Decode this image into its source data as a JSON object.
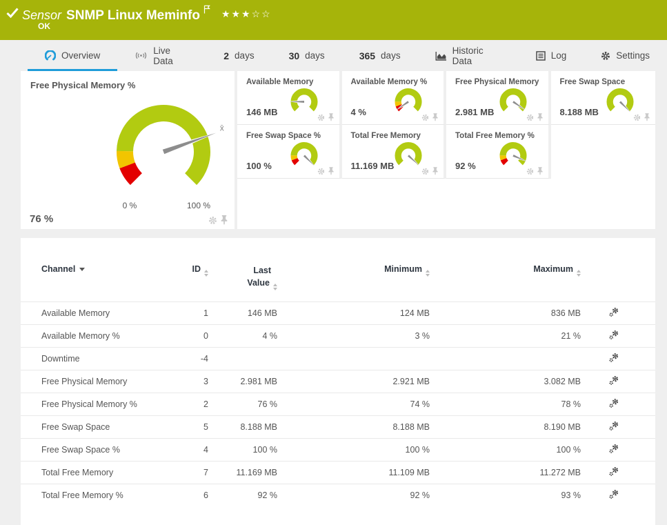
{
  "header": {
    "type_label": "Sensor",
    "title": "SNMP Linux Meminfo",
    "status": "OK",
    "stars_filled": 3,
    "stars_empty": 2
  },
  "tabs": {
    "overview": {
      "label": "Overview"
    },
    "live_data": {
      "label": "Live Data"
    },
    "days2": {
      "number": "2",
      "suffix": "days"
    },
    "days30": {
      "number": "30",
      "suffix": "days"
    },
    "days365": {
      "number": "365",
      "suffix": "days"
    },
    "historic": {
      "label": "Historic Data"
    },
    "log": {
      "label": "Log"
    },
    "settings": {
      "label": "Settings"
    }
  },
  "overview": {
    "main_gauge": {
      "title": "Free Physical Memory %",
      "value_label": "76 %",
      "value_pct": 76,
      "segments": "warn",
      "scale_min": "0 %",
      "scale_max": "100 %",
      "mean_marker": "x̄"
    },
    "mini_gauges": [
      {
        "title": "Available Memory",
        "value_label": "146 MB",
        "value_pct": 17,
        "segments": "plain"
      },
      {
        "title": "Available Memory %",
        "value_label": "4 %",
        "value_pct": 4,
        "segments": "warn"
      },
      {
        "title": "Free Physical Memory",
        "value_label": "2.981 MB",
        "value_pct": 96,
        "segments": "plain"
      },
      {
        "title": "Free Swap Space",
        "value_label": "8.188 MB",
        "value_pct": 100,
        "segments": "plain"
      },
      {
        "title": "Free Swap Space %",
        "value_label": "100 %",
        "value_pct": 100,
        "segments": "warn"
      },
      {
        "title": "Total Free Memory",
        "value_label": "11.169 MB",
        "value_pct": 99,
        "segments": "plain"
      },
      {
        "title": "Total Free Memory %",
        "value_label": "92 %",
        "value_pct": 92,
        "segments": "warn"
      }
    ]
  },
  "table": {
    "columns": {
      "channel": {
        "label": "Channel"
      },
      "id": {
        "label": "ID"
      },
      "last_value": {
        "label_line1": "Last",
        "label_line2": "Value"
      },
      "minimum": {
        "label": "Minimum"
      },
      "maximum": {
        "label": "Maximum"
      }
    },
    "rows": [
      {
        "name": "Available Memory",
        "id": "1",
        "last": "146 MB",
        "min": "124 MB",
        "max": "836 MB"
      },
      {
        "name": "Available Memory %",
        "id": "0",
        "last": "4 %",
        "min": "3 %",
        "max": "21 %"
      },
      {
        "name": "Downtime",
        "id": "-4",
        "last": "",
        "min": "",
        "max": ""
      },
      {
        "name": "Free Physical Memory",
        "id": "3",
        "last": "2.981 MB",
        "min": "2.921 MB",
        "max": "3.082 MB"
      },
      {
        "name": "Free Physical Memory %",
        "id": "2",
        "last": "76 %",
        "min": "74 %",
        "max": "78 %"
      },
      {
        "name": "Free Swap Space",
        "id": "5",
        "last": "8.188 MB",
        "min": "8.188 MB",
        "max": "8.190 MB"
      },
      {
        "name": "Free Swap Space %",
        "id": "4",
        "last": "100 %",
        "min": "100 %",
        "max": "100 %"
      },
      {
        "name": "Total Free Memory",
        "id": "7",
        "last": "11.169 MB",
        "min": "11.109 MB",
        "max": "11.272 MB"
      },
      {
        "name": "Total Free Memory %",
        "id": "6",
        "last": "92 %",
        "min": "92 %",
        "max": "93 %"
      }
    ]
  },
  "colors": {
    "header_bg": "#a6b40a",
    "accent_blue": "#1f9cd9",
    "gauge_green": "#b2cb11",
    "gauge_yellow": "#f2c500",
    "gauge_red": "#e30000",
    "needle_gray": "#8d8d8d"
  }
}
